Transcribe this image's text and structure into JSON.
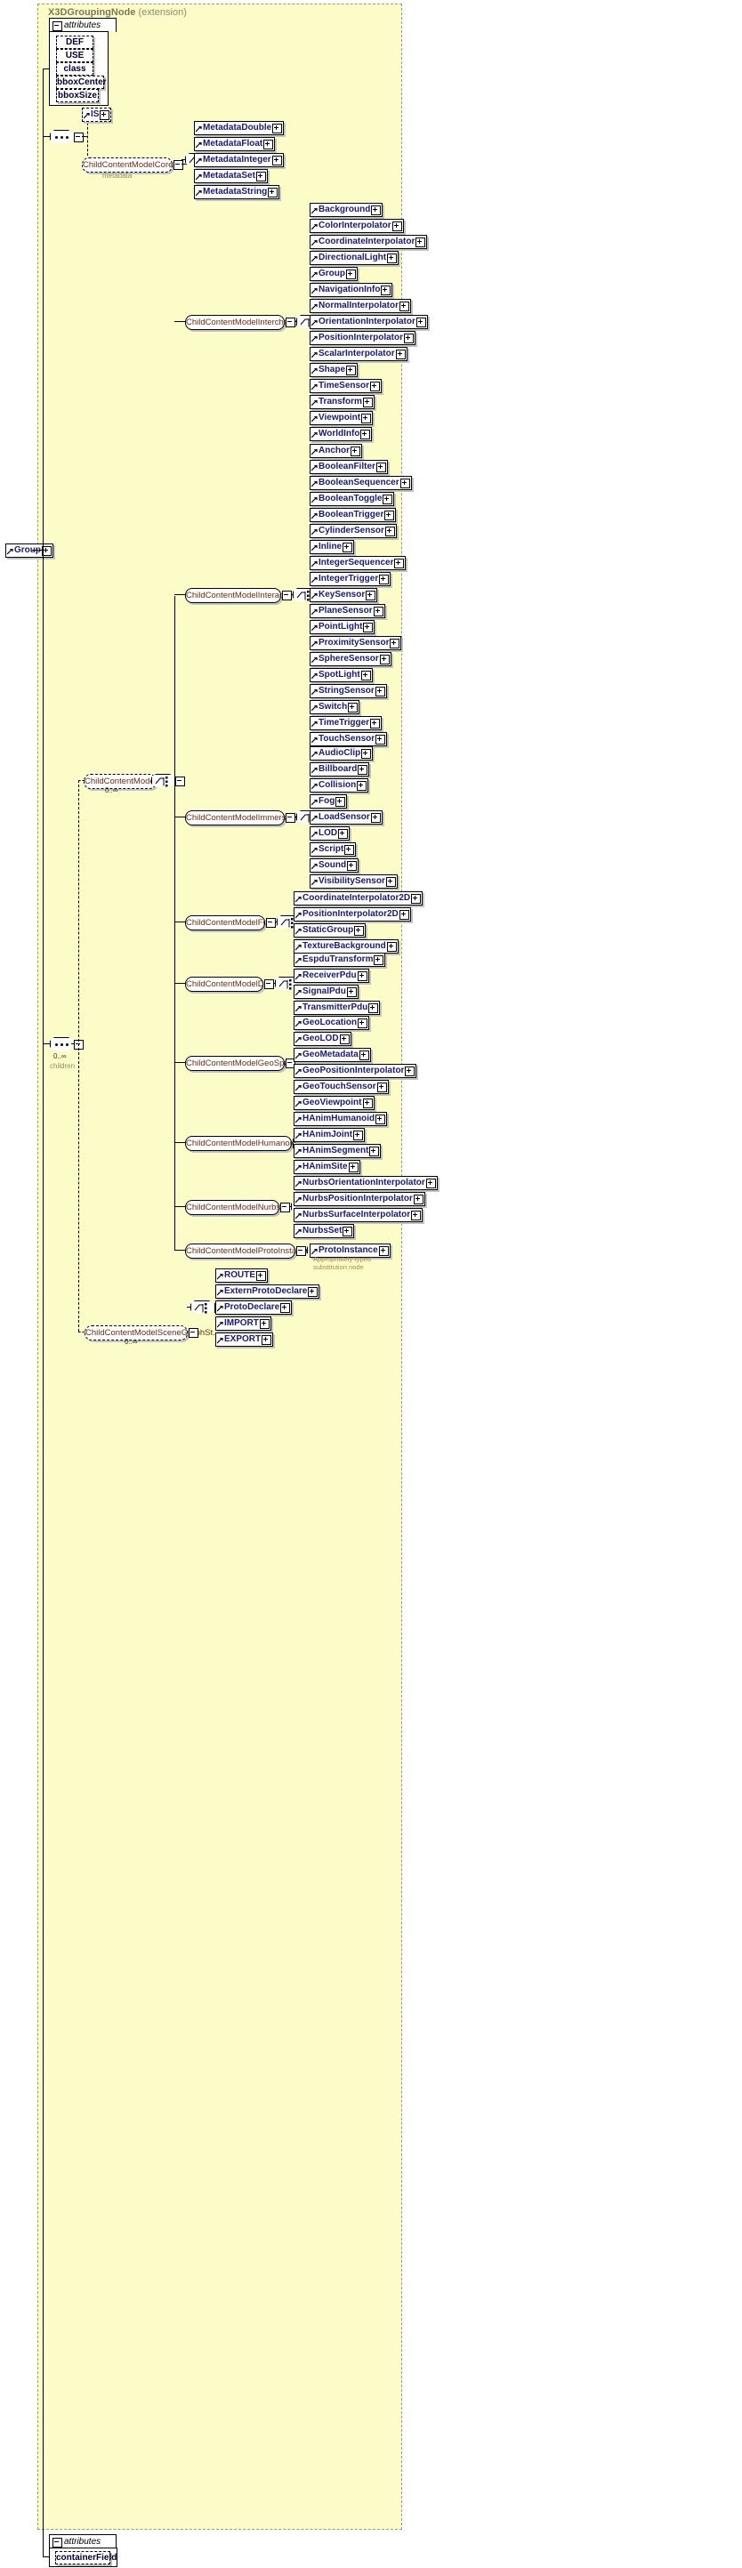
{
  "diagram": {
    "title": "X3DGroupingNode",
    "title_suffix": "(extension)",
    "root_element": "Group",
    "attributes_label": "attributes",
    "attributes": [
      "DEF",
      "USE",
      "class",
      "bboxCenter",
      "bboxSize"
    ],
    "is_node": "IS",
    "metadata_label": "metadata",
    "children_label": "children",
    "children_cardinality": "0..∞",
    "child_content_model": "ChildContentModel",
    "child_content_model_cardinality": "0..∞",
    "proto_note_line1": "Appropriately-typed",
    "proto_note_line2": "substitution node",
    "bottom_attributes_label": "attributes",
    "bottom_attribute": "containerField",
    "groups": [
      {
        "name": "ChildContentModelCore",
        "caption": "metadata",
        "items": [
          "MetadataDouble",
          "MetadataFloat",
          "MetadataInteger",
          "MetadataSet",
          "MetadataString"
        ]
      },
      {
        "name": "ChildContentModelInterchange",
        "items": [
          "Background",
          "ColorInterpolator",
          "CoordinateInterpolator",
          "DirectionalLight",
          "Group",
          "NavigationInfo",
          "NormalInterpolator",
          "OrientationInterpolator",
          "PositionInterpolator",
          "ScalarInterpolator",
          "Shape",
          "TimeSensor",
          "Transform",
          "Viewpoint",
          "WorldInfo"
        ]
      },
      {
        "name": "ChildContentModelInteractive",
        "items": [
          "Anchor",
          "BooleanFilter",
          "BooleanSequencer",
          "BooleanToggle",
          "BooleanTrigger",
          "CylinderSensor",
          "Inline",
          "IntegerSequencer",
          "IntegerTrigger",
          "KeySensor",
          "PlaneSensor",
          "PointLight",
          "ProximitySensor",
          "SphereSensor",
          "SpotLight",
          "StringSensor",
          "Switch",
          "TimeTrigger",
          "TouchSensor"
        ]
      },
      {
        "name": "ChildContentModelImmersive",
        "items": [
          "AudioClip",
          "Billboard",
          "Collision",
          "Fog",
          "LoadSensor",
          "LOD",
          "Script",
          "Sound",
          "VisibilitySensor"
        ]
      },
      {
        "name": "ChildContentModelFull",
        "items": [
          "CoordinateInterpolator2D",
          "PositionInterpolator2D",
          "StaticGroup",
          "TextureBackground"
        ]
      },
      {
        "name": "ChildContentModelDIS",
        "items": [
          "EspduTransform",
          "ReceiverPdu",
          "SignalPdu",
          "TransmitterPdu"
        ]
      },
      {
        "name": "ChildContentModelGeoSpatial",
        "items": [
          "GeoLocation",
          "GeoLOD",
          "GeoMetadata",
          "GeoPositionInterpolator",
          "GeoTouchSensor",
          "GeoViewpoint"
        ]
      },
      {
        "name": "ChildContentModelHumanoidAn...",
        "items": [
          "HAnimHumanoid",
          "HAnimJoint",
          "HAnimSegment",
          "HAnimSite"
        ]
      },
      {
        "name": "ChildContentModelNurbs",
        "items": [
          "NurbsOrientationInterpolator",
          "NurbsPositionInterpolator",
          "NurbsSurfaceInterpolator",
          "NurbsSet"
        ]
      },
      {
        "name": "ChildContentModelProtoInstance",
        "items": [
          "ProtoInstance"
        ]
      },
      {
        "name": "ChildContentModelSceneGraphSt...",
        "cardinality": "0..∞",
        "items": [
          "ROUTE",
          "ExternProtoDeclare",
          "ProtoDeclare",
          "IMPORT",
          "EXPORT"
        ]
      }
    ],
    "colors": {
      "background": "#fcfcc8",
      "node_text": "#1a1a6e",
      "group_text": "#6b2b12",
      "frame": "#9a9a7a"
    }
  }
}
